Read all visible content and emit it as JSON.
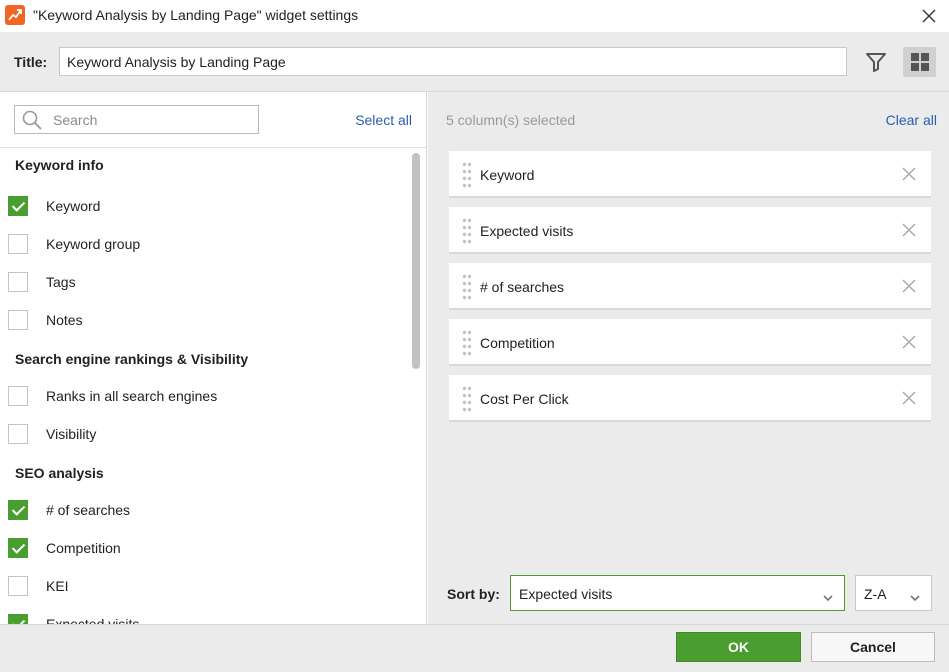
{
  "window": {
    "title": "\"Keyword Analysis by Landing Page\" widget settings"
  },
  "settings": {
    "title_label": "Title:",
    "title_value": "Keyword Analysis by Landing Page"
  },
  "left": {
    "search_placeholder": "Search",
    "select_all": "Select all",
    "groups": [
      {
        "heading": "Keyword info",
        "items": [
          {
            "label": "Keyword",
            "checked": true
          },
          {
            "label": "Keyword group",
            "checked": false
          },
          {
            "label": "Tags",
            "checked": false
          },
          {
            "label": "Notes",
            "checked": false
          }
        ]
      },
      {
        "heading": "Search engine rankings & Visibility",
        "items": [
          {
            "label": "Ranks in all search engines",
            "checked": false
          },
          {
            "label": "Visibility",
            "checked": false
          }
        ]
      },
      {
        "heading": "SEO analysis",
        "items": [
          {
            "label": "# of searches",
            "checked": true
          },
          {
            "label": "Competition",
            "checked": true
          },
          {
            "label": "KEI",
            "checked": false
          },
          {
            "label": "Expected visits",
            "checked": true
          }
        ]
      }
    ]
  },
  "right": {
    "selected_count": "5 column(s) selected",
    "clear_all": "Clear all",
    "columns": [
      "Keyword",
      "Expected visits",
      "# of searches",
      "Competition",
      "Cost Per Click"
    ],
    "sort_label": "Sort by:",
    "sort_value": "Expected visits",
    "order_value": "Z-A"
  },
  "footer": {
    "ok": "OK",
    "cancel": "Cancel"
  },
  "colors": {
    "accent_green": "#4a9e2f",
    "link_blue": "#2a5db0",
    "app_icon": "#f26522"
  }
}
